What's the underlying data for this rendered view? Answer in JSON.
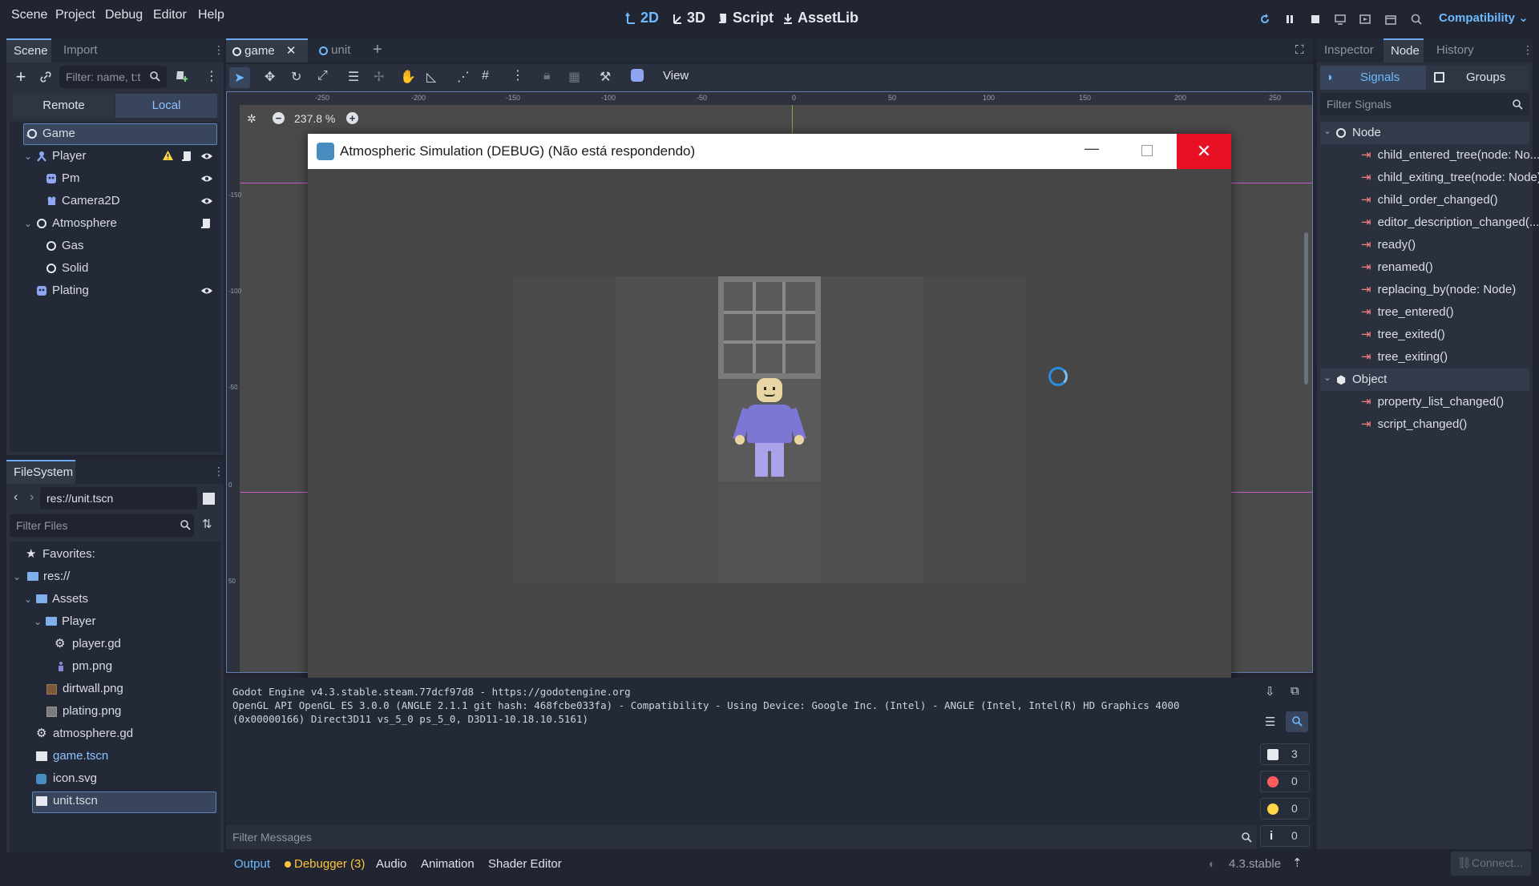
{
  "menu": [
    "Scene",
    "Project",
    "Debug",
    "Editor",
    "Help"
  ],
  "modes": {
    "m2d": "2D",
    "m3d": "3D",
    "script": "Script",
    "assetlib": "AssetLib"
  },
  "renderer": "Compatibility",
  "scene_dock": {
    "tabs": {
      "scene": "Scene",
      "import": "Import"
    },
    "filter_placeholder": "Filter: name, t:t",
    "remote": "Remote",
    "local": "Local",
    "tree": {
      "game": "Game",
      "player": "Player",
      "pm": "Pm",
      "camera": "Camera2D",
      "atmosphere": "Atmosphere",
      "gas": "Gas",
      "solid": "Solid",
      "plating": "Plating"
    }
  },
  "filesystem": {
    "title": "FileSystem",
    "path": "res://unit.tscn",
    "filter_placeholder": "Filter Files",
    "items": {
      "favorites": "Favorites:",
      "res": "res://",
      "assets": "Assets",
      "player": "Player",
      "player_gd": "player.gd",
      "pm_png": "pm.png",
      "dirtwall": "dirtwall.png",
      "plating": "plating.png",
      "atmosphere_gd": "atmosphere.gd",
      "game_tscn": "game.tscn",
      "icon_svg": "icon.svg",
      "unit_tscn": "unit.tscn"
    }
  },
  "editor_tabs": {
    "game": "game",
    "unit": "unit"
  },
  "viewport": {
    "view_label": "View",
    "zoom": "237.8 %",
    "ruler_labels": [
      "-250",
      "-200",
      "-150",
      "-100",
      "-50",
      "0",
      "50",
      "100",
      "150",
      "200",
      "250"
    ],
    "vruler_labels": [
      "-150",
      "-100",
      "-50",
      "0",
      "50"
    ]
  },
  "game_window": {
    "title": "Atmospheric Simulation (DEBUG) (Não está respondendo)"
  },
  "output": {
    "lines": [
      "Godot Engine v4.3.stable.steam.77dcf97d8 - https://godotengine.org",
      "OpenGL API OpenGL ES 3.0.0 (ANGLE 2.1.1 git hash: 468fcbe033fa) - Compatibility - Using Device: Google Inc. (Intel) - ANGLE (Intel, Intel(R) HD Graphics 4000",
      "(0x00000166) Direct3D11 vs_5_0 ps_5_0, D3D11-10.18.10.5161)"
    ],
    "filter_placeholder": "Filter Messages",
    "counts": {
      "messages": "3",
      "errors": "0",
      "warnings": "0",
      "info": "0"
    }
  },
  "bottom_tabs": {
    "output": "Output",
    "debugger": "Debugger (3)",
    "audio": "Audio",
    "animation": "Animation",
    "shader": "Shader Editor"
  },
  "version": "4.3.stable",
  "right_dock": {
    "tabs": {
      "inspector": "Inspector",
      "node": "Node",
      "history": "History"
    },
    "signals_tab": "Signals",
    "groups_tab": "Groups",
    "filter_placeholder": "Filter Signals",
    "node_header": "Node",
    "node_signals": [
      "child_entered_tree(node: No...",
      "child_exiting_tree(node: Node)",
      "child_order_changed()",
      "editor_description_changed(...",
      "ready()",
      "renamed()",
      "replacing_by(node: Node)",
      "tree_entered()",
      "tree_exited()",
      "tree_exiting()"
    ],
    "object_header": "Object",
    "object_signals": [
      "property_list_changed()",
      "script_changed()"
    ],
    "connect": "Connect..."
  },
  "colors": {
    "accent": "#6eb9ff",
    "close_red": "#e81123",
    "signal_icon": "#ff7d7d",
    "player_purple": "#7c77d4"
  }
}
